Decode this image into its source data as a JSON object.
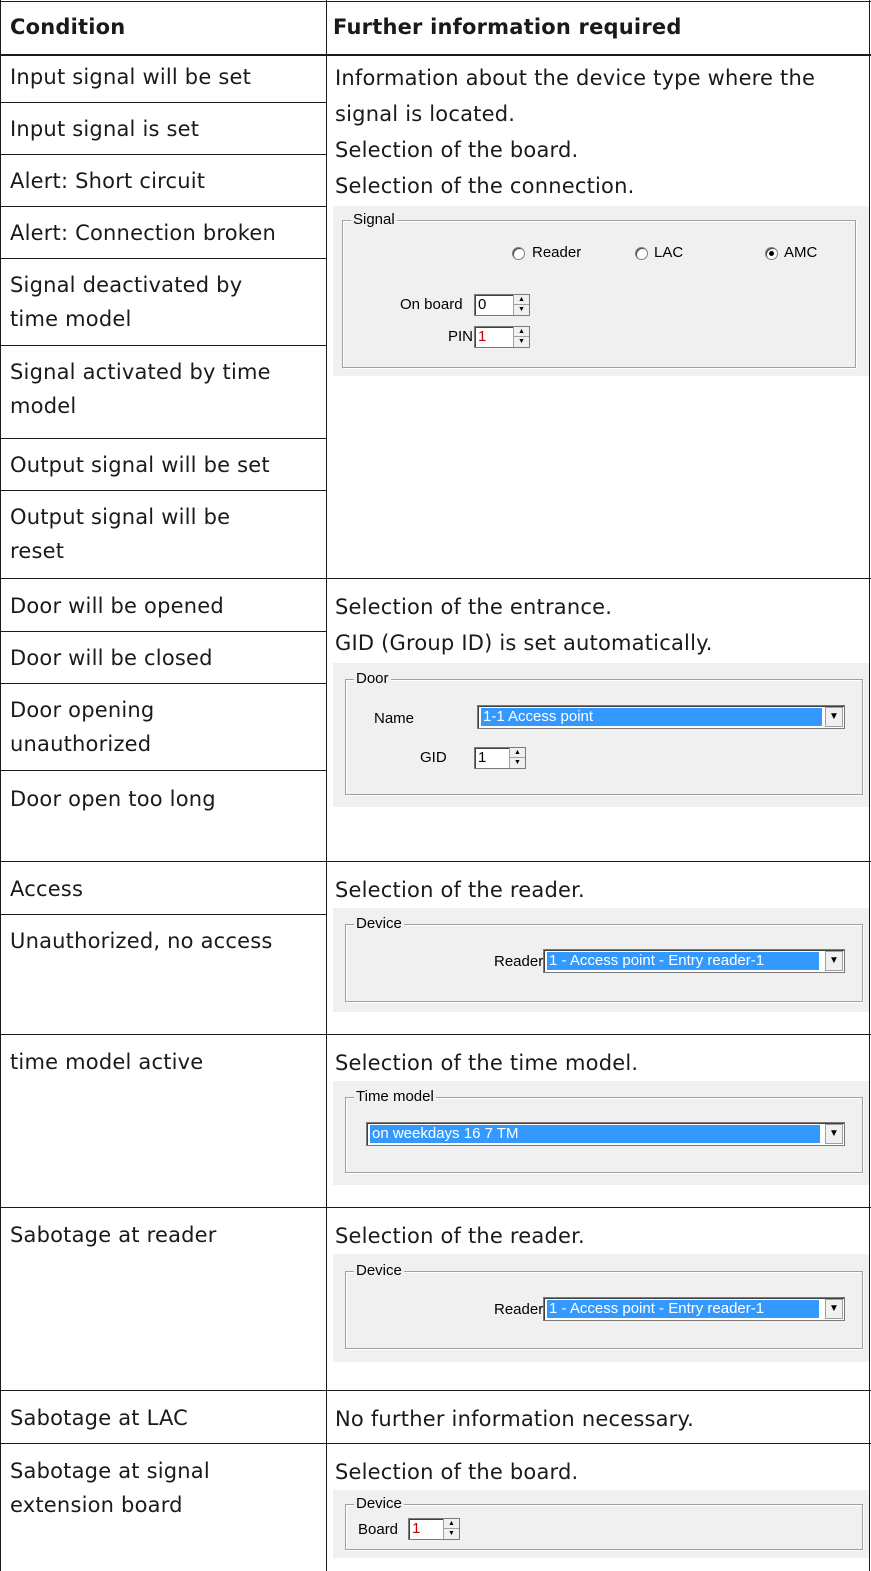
{
  "header": {
    "condition": "Condition",
    "info": "Further information required"
  },
  "rows": {
    "signal_conditions": [
      "Input signal will be set",
      "Input signal is set",
      "Alert: Short circuit",
      "Alert: Connection broken",
      "Signal deactivated by time model",
      "Signal activated by time model",
      "Output signal will be set",
      "Output signal will be reset"
    ],
    "signal_info": [
      "Information about the device type where the",
      "signal is located.",
      "Selection of the board.",
      "Selection of the connection."
    ],
    "door_conditions": [
      "Door will be opened",
      "Door will be closed",
      "Door opening unauthorized",
      "Door open too long"
    ],
    "door_info": [
      "Selection of the entrance.",
      "GID (Group ID) is set automatically."
    ],
    "access_conditions": [
      "Access",
      "Unauthorized, no access"
    ],
    "access_info": "Selection of the reader.",
    "time_condition": "time model active",
    "time_info": "Selection of the time model.",
    "sabotage_reader_condition": "Sabotage at reader",
    "sabotage_reader_info": "Selection of the reader.",
    "sabotage_lac_condition": "Sabotage at LAC",
    "sabotage_lac_info": "No further information necessary.",
    "sabotage_board_condition": "Sabotage at signal extension board",
    "sabotage_board_info": "Selection of the board."
  },
  "signal_panel": {
    "group": "Signal",
    "radio_reader": "Reader",
    "radio_lac": "LAC",
    "radio_amc": "AMC",
    "selected": "AMC",
    "onboard_label": "On board",
    "onboard_value": "0",
    "pin_label": "PIN",
    "pin_value": "1"
  },
  "door_panel": {
    "group": "Door",
    "name_label": "Name",
    "name_value": "1-1 Access point",
    "gid_label": "GID",
    "gid_value": "1"
  },
  "access_device_panel": {
    "group": "Device",
    "reader_label": "Reader",
    "reader_value": "1 - Access point - Entry reader-1"
  },
  "time_panel": {
    "group": "Time model",
    "value": "on weekdays 16 7 TM"
  },
  "sabotage_device_panel": {
    "group": "Device",
    "reader_label": "Reader",
    "reader_value": "1 - Access point - Entry reader-1"
  },
  "board_panel": {
    "group": "Device",
    "board_label": "Board",
    "board_value": "1"
  }
}
